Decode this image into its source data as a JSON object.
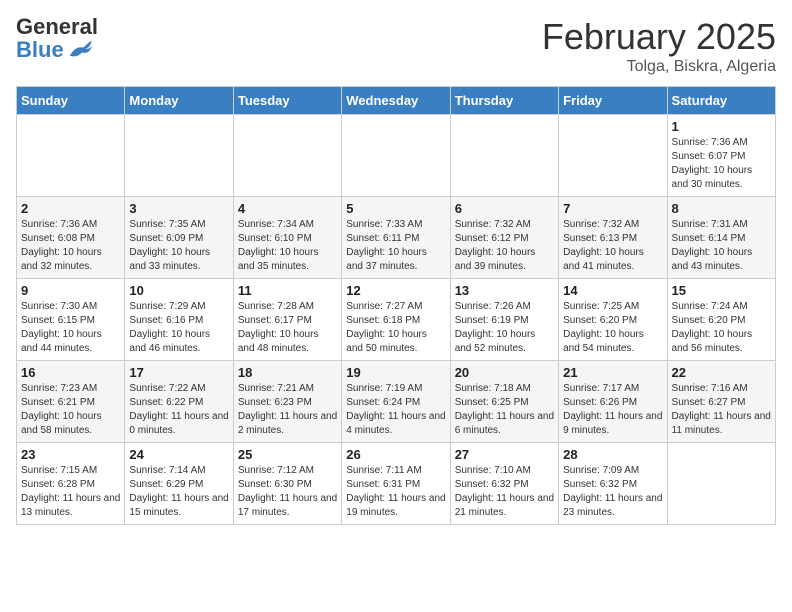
{
  "header": {
    "logo_general": "General",
    "logo_blue": "Blue",
    "month_title": "February 2025",
    "location": "Tolga, Biskra, Algeria"
  },
  "days_of_week": [
    "Sunday",
    "Monday",
    "Tuesday",
    "Wednesday",
    "Thursday",
    "Friday",
    "Saturday"
  ],
  "weeks": [
    [
      {
        "num": "",
        "info": ""
      },
      {
        "num": "",
        "info": ""
      },
      {
        "num": "",
        "info": ""
      },
      {
        "num": "",
        "info": ""
      },
      {
        "num": "",
        "info": ""
      },
      {
        "num": "",
        "info": ""
      },
      {
        "num": "1",
        "info": "Sunrise: 7:36 AM\nSunset: 6:07 PM\nDaylight: 10 hours and 30 minutes."
      }
    ],
    [
      {
        "num": "2",
        "info": "Sunrise: 7:36 AM\nSunset: 6:08 PM\nDaylight: 10 hours and 32 minutes."
      },
      {
        "num": "3",
        "info": "Sunrise: 7:35 AM\nSunset: 6:09 PM\nDaylight: 10 hours and 33 minutes."
      },
      {
        "num": "4",
        "info": "Sunrise: 7:34 AM\nSunset: 6:10 PM\nDaylight: 10 hours and 35 minutes."
      },
      {
        "num": "5",
        "info": "Sunrise: 7:33 AM\nSunset: 6:11 PM\nDaylight: 10 hours and 37 minutes."
      },
      {
        "num": "6",
        "info": "Sunrise: 7:32 AM\nSunset: 6:12 PM\nDaylight: 10 hours and 39 minutes."
      },
      {
        "num": "7",
        "info": "Sunrise: 7:32 AM\nSunset: 6:13 PM\nDaylight: 10 hours and 41 minutes."
      },
      {
        "num": "8",
        "info": "Sunrise: 7:31 AM\nSunset: 6:14 PM\nDaylight: 10 hours and 43 minutes."
      }
    ],
    [
      {
        "num": "9",
        "info": "Sunrise: 7:30 AM\nSunset: 6:15 PM\nDaylight: 10 hours and 44 minutes."
      },
      {
        "num": "10",
        "info": "Sunrise: 7:29 AM\nSunset: 6:16 PM\nDaylight: 10 hours and 46 minutes."
      },
      {
        "num": "11",
        "info": "Sunrise: 7:28 AM\nSunset: 6:17 PM\nDaylight: 10 hours and 48 minutes."
      },
      {
        "num": "12",
        "info": "Sunrise: 7:27 AM\nSunset: 6:18 PM\nDaylight: 10 hours and 50 minutes."
      },
      {
        "num": "13",
        "info": "Sunrise: 7:26 AM\nSunset: 6:19 PM\nDaylight: 10 hours and 52 minutes."
      },
      {
        "num": "14",
        "info": "Sunrise: 7:25 AM\nSunset: 6:20 PM\nDaylight: 10 hours and 54 minutes."
      },
      {
        "num": "15",
        "info": "Sunrise: 7:24 AM\nSunset: 6:20 PM\nDaylight: 10 hours and 56 minutes."
      }
    ],
    [
      {
        "num": "16",
        "info": "Sunrise: 7:23 AM\nSunset: 6:21 PM\nDaylight: 10 hours and 58 minutes."
      },
      {
        "num": "17",
        "info": "Sunrise: 7:22 AM\nSunset: 6:22 PM\nDaylight: 11 hours and 0 minutes."
      },
      {
        "num": "18",
        "info": "Sunrise: 7:21 AM\nSunset: 6:23 PM\nDaylight: 11 hours and 2 minutes."
      },
      {
        "num": "19",
        "info": "Sunrise: 7:19 AM\nSunset: 6:24 PM\nDaylight: 11 hours and 4 minutes."
      },
      {
        "num": "20",
        "info": "Sunrise: 7:18 AM\nSunset: 6:25 PM\nDaylight: 11 hours and 6 minutes."
      },
      {
        "num": "21",
        "info": "Sunrise: 7:17 AM\nSunset: 6:26 PM\nDaylight: 11 hours and 9 minutes."
      },
      {
        "num": "22",
        "info": "Sunrise: 7:16 AM\nSunset: 6:27 PM\nDaylight: 11 hours and 11 minutes."
      }
    ],
    [
      {
        "num": "23",
        "info": "Sunrise: 7:15 AM\nSunset: 6:28 PM\nDaylight: 11 hours and 13 minutes."
      },
      {
        "num": "24",
        "info": "Sunrise: 7:14 AM\nSunset: 6:29 PM\nDaylight: 11 hours and 15 minutes."
      },
      {
        "num": "25",
        "info": "Sunrise: 7:12 AM\nSunset: 6:30 PM\nDaylight: 11 hours and 17 minutes."
      },
      {
        "num": "26",
        "info": "Sunrise: 7:11 AM\nSunset: 6:31 PM\nDaylight: 11 hours and 19 minutes."
      },
      {
        "num": "27",
        "info": "Sunrise: 7:10 AM\nSunset: 6:32 PM\nDaylight: 11 hours and 21 minutes."
      },
      {
        "num": "28",
        "info": "Sunrise: 7:09 AM\nSunset: 6:32 PM\nDaylight: 11 hours and 23 minutes."
      },
      {
        "num": "",
        "info": ""
      }
    ]
  ]
}
